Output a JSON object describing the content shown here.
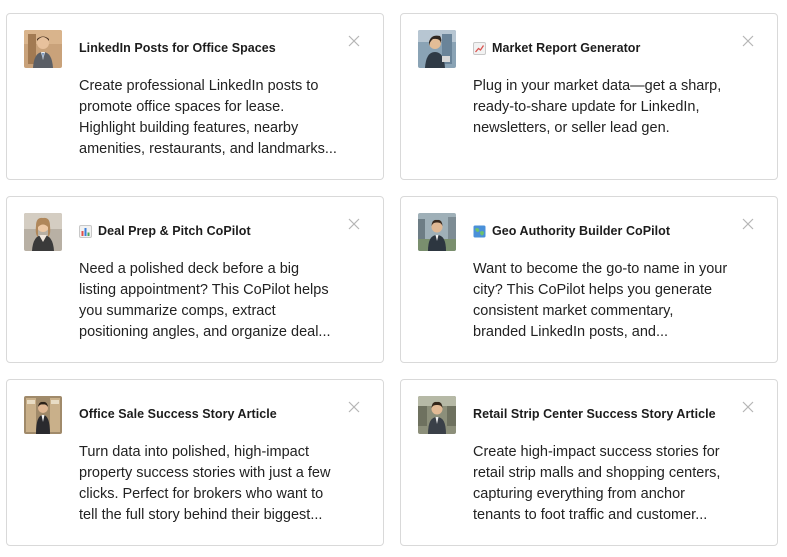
{
  "cards": [
    {
      "title": "LinkedIn Posts for Office Spaces",
      "emoji": "",
      "lines": [
        "Create professional LinkedIn posts to",
        "promote office spaces for lease.",
        "Highlight building features, nearby",
        "amenities, restaurants, and landmarks..."
      ],
      "avatar_bg": "#c9a27a"
    },
    {
      "title": "Market Report Generator",
      "emoji": "chart-increasing-icon",
      "lines": [
        "Plug in your market data—get a sharp,",
        "ready-to-share update for LinkedIn,",
        "newsletters, or seller lead gen."
      ],
      "avatar_bg": "#8aa3b5"
    },
    {
      "title": "Deal Prep & Pitch CoPilot",
      "emoji": "bar-chart-icon",
      "lines": [
        "Need a polished deck before a big",
        "listing appointment? This CoPilot helps",
        "you summarize comps, extract",
        "positioning angles, and organize deal..."
      ],
      "avatar_bg": "#b8b0a4"
    },
    {
      "title": "Geo Authority Builder CoPilot",
      "emoji": "world-map-icon",
      "lines": [
        "Want to become the go-to name in your",
        "city? This CoPilot helps you generate",
        "consistent market commentary,",
        "branded LinkedIn posts, and..."
      ],
      "avatar_bg": "#7a8f6e"
    },
    {
      "title": "Office Sale Success Story Article",
      "emoji": "",
      "lines": [
        "Turn data into polished, high-impact",
        "property success stories with just a few",
        "clicks. Perfect for brokers who want to",
        "tell the full story behind their biggest..."
      ],
      "avatar_bg": "#a08a6a"
    },
    {
      "title": "Retail Strip Center Success Story Article",
      "emoji": "",
      "lines": [
        "Create high-impact success stories for",
        "retail strip malls and shopping centers,",
        "capturing everything from anchor",
        "tenants to foot traffic and customer..."
      ],
      "avatar_bg": "#8c8f7a"
    }
  ]
}
